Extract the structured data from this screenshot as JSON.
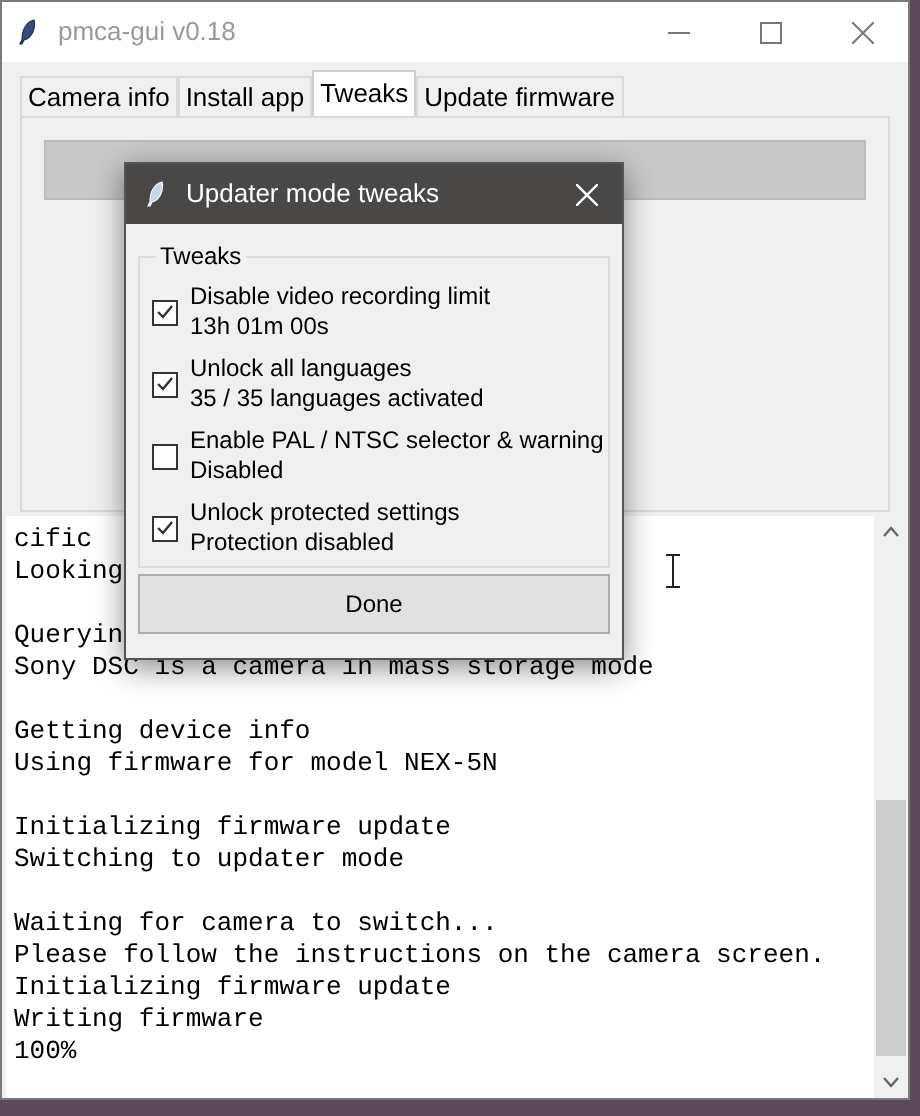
{
  "window": {
    "title": "pmca-gui v0.18"
  },
  "tabs": [
    {
      "label": "Camera info",
      "selected": false
    },
    {
      "label": "Install app",
      "selected": false
    },
    {
      "label": "Tweaks",
      "selected": true
    },
    {
      "label": "Update firmware",
      "selected": false
    }
  ],
  "log": {
    "blocks": [
      [
        "cific",
        "Looking"
      ],
      [
        "Queryin",
        "Sony DSC is a camera in mass storage mode"
      ],
      [
        "Getting device info",
        "Using firmware for model NEX-5N"
      ],
      [
        "Initializing firmware update",
        "Switching to updater mode"
      ],
      [
        "Waiting for camera to switch...",
        "Please follow the instructions on the camera screen.",
        "Initializing firmware update",
        "Writing firmware",
        "100%"
      ]
    ]
  },
  "dialog": {
    "title": "Updater mode tweaks",
    "group_label": "Tweaks",
    "options": [
      {
        "label": "Disable video recording limit",
        "status": "13h 01m 00s",
        "checked": true
      },
      {
        "label": "Unlock all languages",
        "status": "35 / 35 languages activated",
        "checked": true
      },
      {
        "label": "Enable PAL / NTSC selector & warning",
        "status": "Disabled",
        "checked": false
      },
      {
        "label": "Unlock protected settings",
        "status": "Protection disabled",
        "checked": true
      }
    ],
    "button": "Done"
  }
}
